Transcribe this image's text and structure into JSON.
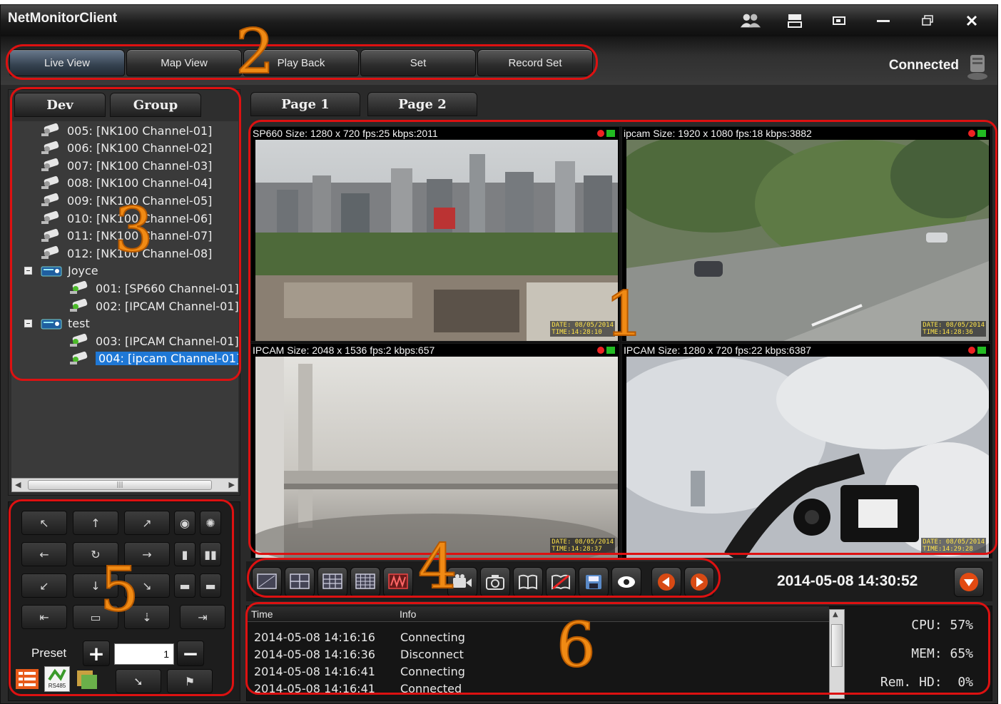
{
  "window": {
    "title": "NetMonitorClient",
    "buttons": [
      "users-icon",
      "layout-icon",
      "restore-small-icon",
      "minimize-icon",
      "maximize-icon",
      "close-icon"
    ]
  },
  "menu": {
    "tabs": [
      "Live View",
      "Map View",
      "Play Back",
      "Set",
      "Record Set"
    ],
    "status": "Connected"
  },
  "left_tabs": [
    "Dev",
    "Group"
  ],
  "tree": [
    {
      "label": "005: [NK100 Channel-01]",
      "type": "camera",
      "level": 1
    },
    {
      "label": "006: [NK100 Channel-02]",
      "type": "camera",
      "level": 1
    },
    {
      "label": "007: [NK100 Channel-03]",
      "type": "camera",
      "level": 1
    },
    {
      "label": "008: [NK100 Channel-04]",
      "type": "camera",
      "level": 1
    },
    {
      "label": "009: [NK100 Channel-05]",
      "type": "camera",
      "level": 1
    },
    {
      "label": "010: [NK100 Channel-06]",
      "type": "camera",
      "level": 1
    },
    {
      "label": "011: [NK100 Channel-07]",
      "type": "camera",
      "level": 1
    },
    {
      "label": "012: [NK100 Channel-08]",
      "type": "camera",
      "level": 1
    },
    {
      "label": "Joyce",
      "type": "group",
      "level": 0
    },
    {
      "label": "001: [SP660 Channel-01]",
      "type": "camera-active",
      "level": 2
    },
    {
      "label": "002: [IPCAM Channel-01]",
      "type": "camera-active",
      "level": 2
    },
    {
      "label": "test",
      "type": "group",
      "level": 0
    },
    {
      "label": "003: [IPCAM Channel-01]",
      "type": "camera-active",
      "level": 2
    },
    {
      "label": "004: [ipcam Channel-01]",
      "type": "camera-active",
      "level": 2,
      "selected": true
    }
  ],
  "ptz": {
    "preset_label": "Preset",
    "preset_value": "1",
    "rs485_label": "RS485"
  },
  "page_tabs": [
    "Page 1",
    "Page 2"
  ],
  "tiles": [
    {
      "header": "SP660 Size: 1280 x 720 fps:25 kbps:2011",
      "osd": "DATE: 08/05/2014\nTIME:14:28:10",
      "scene": "city"
    },
    {
      "header": "ipcam Size: 1920 x 1080 fps:18 kbps:3882",
      "osd": "DATE: 08/05/2014\nTIME:14:28:36",
      "scene": "street"
    },
    {
      "header": "IPCAM Size: 2048 x 1536 fps:2 kbps:657",
      "osd": "DATE: 08/05/2014\nTIME:14:28:37",
      "scene": "wall"
    },
    {
      "header": "IPCAM Size: 1280 x 720 fps:22 kbps:6387",
      "osd": "DATE: 08/05/2014\nTIME:14:29:28",
      "scene": "cable"
    }
  ],
  "controls": {
    "buttons": [
      "layout-1-icon",
      "layout-4-icon",
      "layout-9-icon",
      "layout-16-icon",
      "sequence-icon",
      "record-icon",
      "snapshot-icon",
      "book-icon",
      "book-off-icon",
      "save-icon",
      "eye-icon",
      "prev-icon",
      "next-icon"
    ],
    "datetime": "2014-05-08 14:30:52"
  },
  "log": {
    "columns": [
      "Time",
      "Info"
    ],
    "rows": [
      {
        "time": "2014-05-08 14:16:16",
        "info": "Connecting"
      },
      {
        "time": "2014-05-08 14:16:36",
        "info": "Disconnect"
      },
      {
        "time": "2014-05-08 14:16:41",
        "info": "Connecting"
      },
      {
        "time": "2014-05-08 14:16:41",
        "info": "Connected"
      }
    ]
  },
  "stats": {
    "cpu_label": "CPU:",
    "cpu_value": "57%",
    "mem_label": "MEM:",
    "mem_value": "65%",
    "hd_label": "Rem. HD:",
    "hd_value": "0%"
  },
  "annotations": [
    "1",
    "2",
    "3",
    "4",
    "5",
    "6"
  ],
  "colors": {
    "annotation_box": "#dd1111",
    "annotation_number": "#f08a14",
    "selection": "#1f78d6"
  }
}
